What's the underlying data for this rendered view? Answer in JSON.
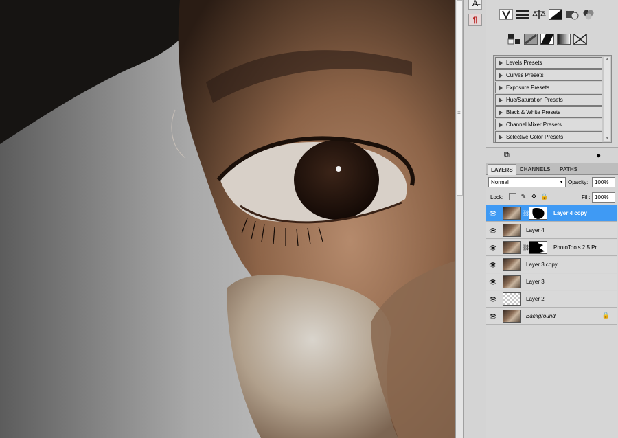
{
  "toolstrip": {
    "items": [
      {
        "name": "character-panel-icon",
        "glyph": "A̶"
      },
      {
        "name": "paragraph-panel-icon",
        "glyph": "¶"
      }
    ]
  },
  "adjustments": {
    "icons_row1": [
      "vibrance-icon",
      "color-balance-icon",
      "black-white-icon",
      "photo-filter-icon",
      "channel-mixer-icon",
      "balance-scale-icon"
    ],
    "icons_row2": [
      "invert-icon",
      "posterize-icon",
      "threshold-icon",
      "gradient-map-icon",
      "selective-color-icon"
    ],
    "presets": [
      "Levels Presets",
      "Curves Presets",
      "Exposure Presets",
      "Hue/Saturation Presets",
      "Black & White Presets",
      "Channel Mixer Presets",
      "Selective Color Presets"
    ]
  },
  "layers_panel": {
    "tabs": [
      "LAYERS",
      "CHANNELS",
      "PATHS"
    ],
    "blend_mode": "Normal",
    "opacity_label": "Opacity:",
    "opacity": "100%",
    "lock_label": "Lock:",
    "fill_label": "Fill:",
    "fill": "100%",
    "layers": [
      {
        "name": "Layer 4 copy",
        "selected": true,
        "mask": true,
        "italic": false,
        "thumb": "photo"
      },
      {
        "name": "Layer 4",
        "selected": false,
        "mask": false,
        "italic": false,
        "thumb": "photo"
      },
      {
        "name": "PhotoTools 2.5 Pr...",
        "selected": false,
        "mask": true,
        "italic": false,
        "thumb": "photo"
      },
      {
        "name": "Layer 3 copy",
        "selected": false,
        "mask": false,
        "italic": false,
        "thumb": "photo"
      },
      {
        "name": "Layer 3",
        "selected": false,
        "mask": false,
        "italic": false,
        "thumb": "photo"
      },
      {
        "name": "Layer 2",
        "selected": false,
        "mask": false,
        "italic": false,
        "thumb": "checker"
      },
      {
        "name": "Background",
        "selected": false,
        "mask": false,
        "italic": true,
        "thumb": "photo",
        "locked": true
      }
    ]
  },
  "colors": {
    "selection": "#3f9af4",
    "panel_bg": "#d6d6d6"
  }
}
